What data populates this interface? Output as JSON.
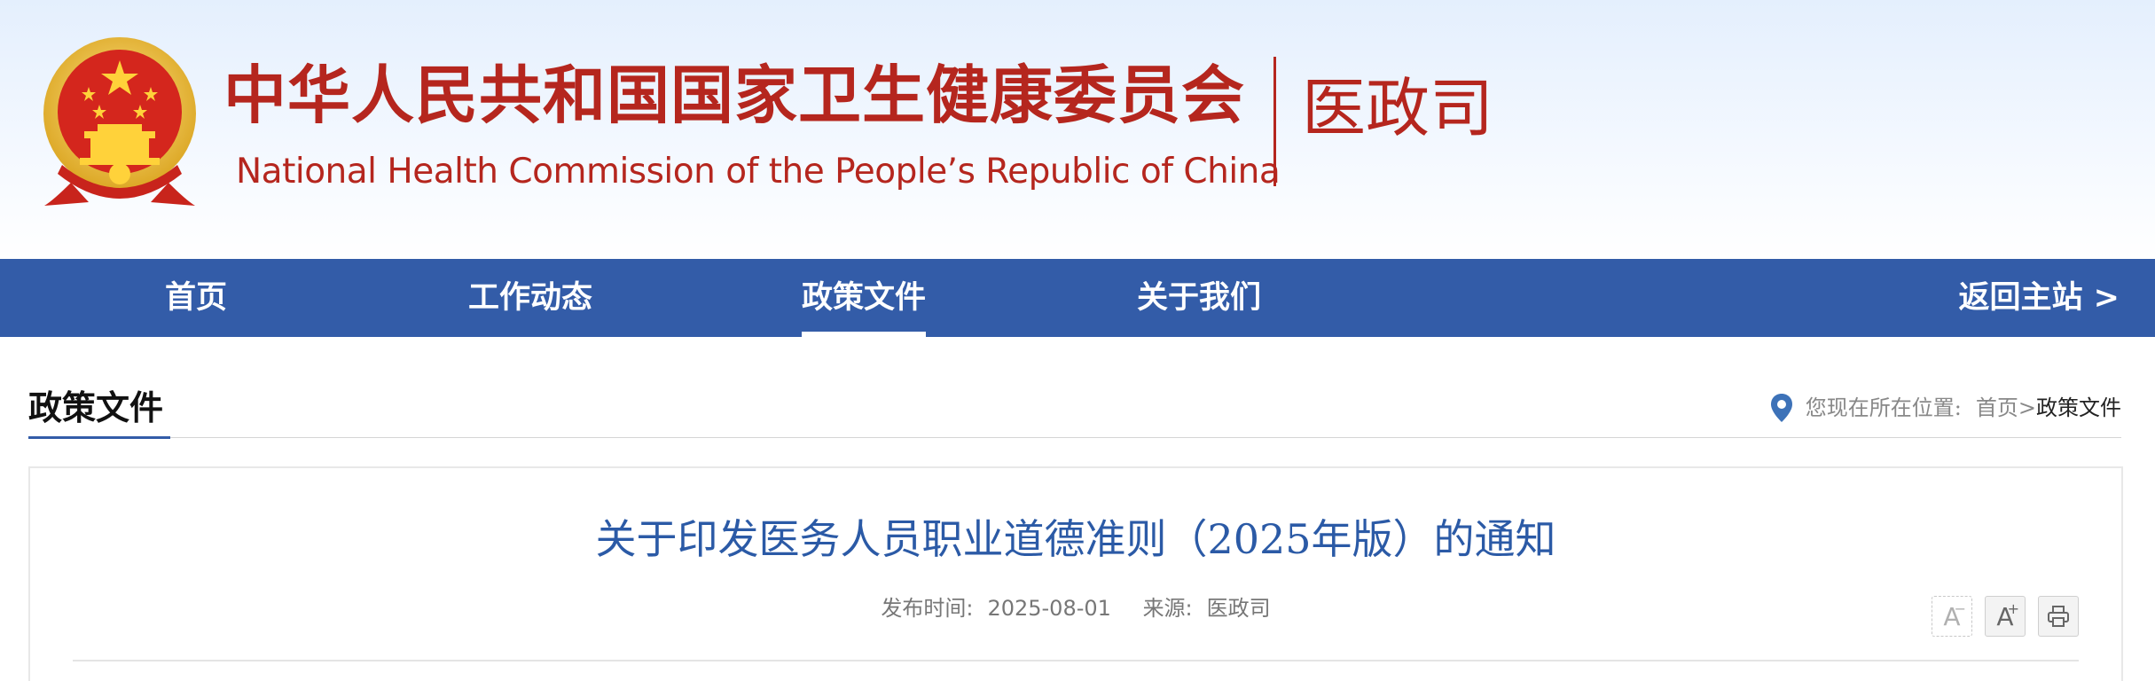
{
  "header": {
    "cn_title": "中华人民共和国国家卫生健康委员会",
    "en_title": "National Health Commission of the People’s  Republic of China",
    "department": "医政司",
    "emblem_icon": "national-emblem-icon"
  },
  "nav": {
    "items": [
      {
        "label": "首页",
        "active": false
      },
      {
        "label": "工作动态",
        "active": false
      },
      {
        "label": "政策文件",
        "active": true
      },
      {
        "label": "关于我们",
        "active": false
      }
    ],
    "back_label": "返回主站 >"
  },
  "section": {
    "title": "政策文件",
    "breadcrumb": {
      "prefix": "您现在所在位置:",
      "home": "首页",
      "separator": ">",
      "current": "政策文件"
    }
  },
  "article": {
    "title": "关于印发医务人员职业道德准则（2025年版）的通知",
    "publish_label": "发布时间:",
    "publish_date": "2025-08-01",
    "source_label": "来源:",
    "source": "医政司",
    "tools": {
      "decrease_font": "A",
      "decrease_mark": "−",
      "increase_font": "A",
      "increase_mark": "+",
      "print_icon": "printer-icon"
    }
  },
  "colors": {
    "brand_red": "#b5261e",
    "nav_blue": "#335ca8",
    "title_blue": "#2b5aa6"
  }
}
